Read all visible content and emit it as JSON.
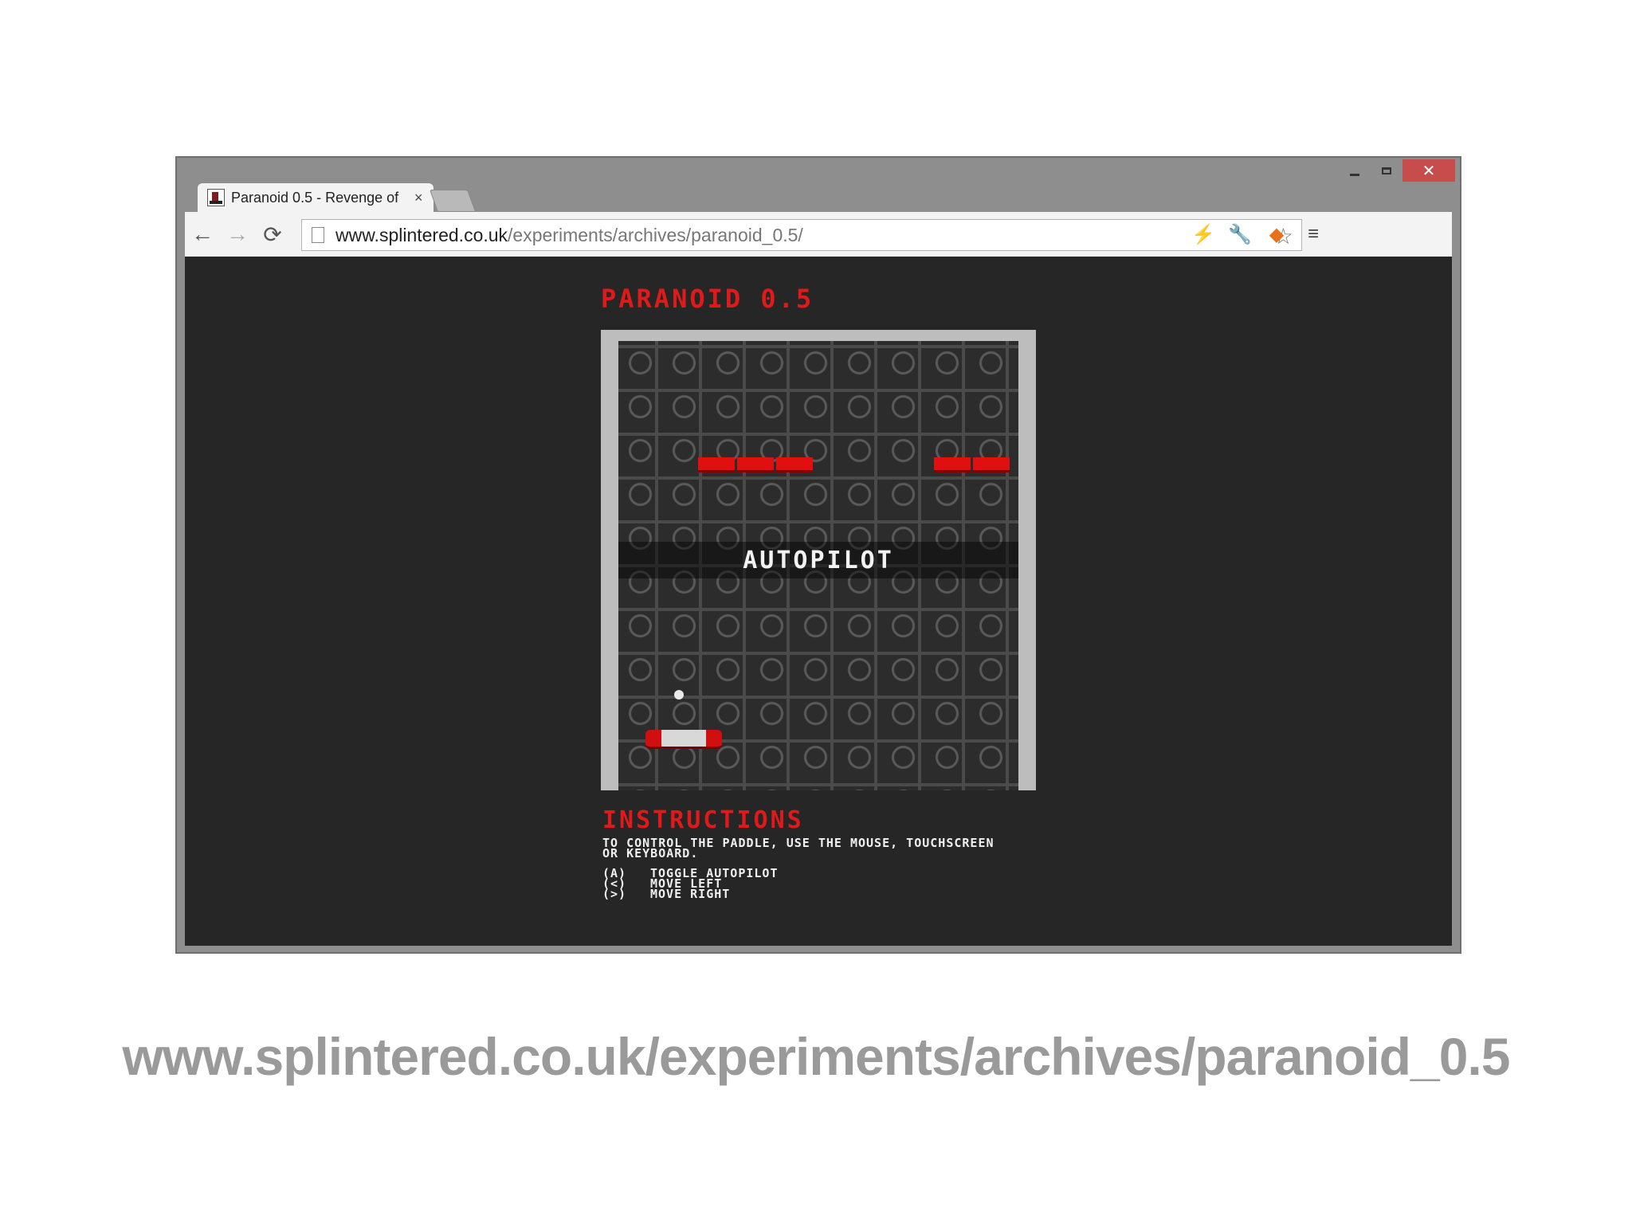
{
  "browser": {
    "tab": {
      "title": "Paranoid 0.5 - Revenge of",
      "close": "×"
    },
    "window_controls": {
      "close": "✕"
    },
    "address": {
      "host": "www.splintered.co.uk",
      "path": "/experiments/archives/paranoid_0.5/"
    }
  },
  "game": {
    "title": "PARANOID 0.5",
    "banner": "AUTOPILOT",
    "instructions_title": "INSTRUCTIONS",
    "instructions_text": "TO CONTROL THE PADDLE, USE THE MOUSE, TOUCHSCREEN OR KEYBOARD.",
    "keys": [
      {
        "key": "(A)",
        "action": "TOGGLE AUTOPILOT"
      },
      {
        "key": "(<)",
        "action": "MOVE LEFT"
      },
      {
        "key": "(>)",
        "action": "MOVE RIGHT"
      }
    ]
  },
  "caption": "www.splintered.co.uk/experiments/archives/paranoid_0.5",
  "colors": {
    "brick": "#e01010",
    "title_red": "#e01a1a",
    "close_button": "#c74d4d"
  }
}
